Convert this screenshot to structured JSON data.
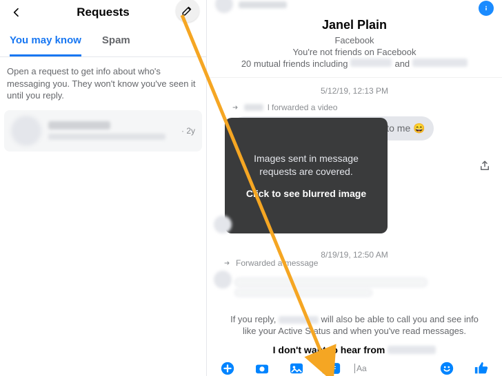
{
  "left": {
    "title": "Requests",
    "tabs": {
      "you_may_know": "You may know",
      "spam": "Spam"
    },
    "hint": "Open a request to get info about who's messaging you. They won't know you've seen it until you reply.",
    "item_time": "· 2y"
  },
  "chat": {
    "name": "Janel Plain",
    "platform": "Facebook",
    "not_friends": "You're not friends on Facebook",
    "mutual_prefix": "20 mutual friends including ",
    "mutual_and": " and "
  },
  "thread": {
    "ts1": "5/12/19, 12:13 PM",
    "fwd1_suffix": "l forwarded a video",
    "bubble1": "This is a cool one that was sent to me 😄",
    "overlay_line1": "Images sent in message requests are covered.",
    "overlay_line2": "Click to see blurred image",
    "ts2": "8/19/19, 12:50 AM",
    "fwd2": "Forwarded a message"
  },
  "footer": {
    "note_prefix": "If you reply, ",
    "note_suffix": " will also be able to call you and see info like your Active Status and when you've read messages.",
    "block_prefix": "I don't want to hear from ",
    "input_placeholder": "Aa"
  }
}
